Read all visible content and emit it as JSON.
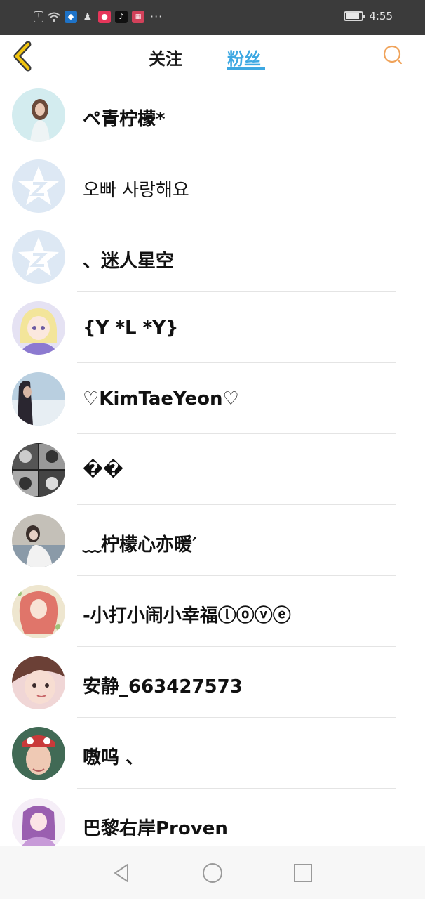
{
  "status_bar": {
    "time": "4:55",
    "icons": [
      "alert-icon",
      "wifi-icon",
      "shield-app-icon",
      "qq-icon",
      "camera-app-icon",
      "tiktok-icon",
      "video-app-icon"
    ],
    "more": "···",
    "battery_level": 0.85
  },
  "header": {
    "back_icon": "back-chevron-icon",
    "tab_follow": "关注",
    "tab_fans": "粉丝",
    "active_tab": "粉丝",
    "search_icon": "search-icon",
    "accent": "#3da8e2"
  },
  "fans": [
    {
      "name": "ペ青柠檬*",
      "avatar": "photo-girl"
    },
    {
      "name": "오빠 사랑해요",
      "avatar": "default-z"
    },
    {
      "name": "、迷人星空",
      "avatar": "default-z"
    },
    {
      "name": "{Y *L *Y}",
      "avatar": "anime-girl"
    },
    {
      "name": "♡KimTaeYeon♡",
      "avatar": "photo-dark"
    },
    {
      "name": "��",
      "avatar": "photo-grid"
    },
    {
      "name": "﹏柠檬心亦暖′",
      "avatar": "photo-sitting"
    },
    {
      "name": "-小打小闹小幸福ⓛⓞⓥⓔ",
      "avatar": "anime-red"
    },
    {
      "name": "安静_663427573",
      "avatar": "photo-face"
    },
    {
      "name": "嗷呜 、",
      "avatar": "photo-cap"
    },
    {
      "name": "巴黎右岸Proven",
      "avatar": "anime-purple"
    }
  ],
  "nav": {
    "back": "nav-back-icon",
    "home": "nav-home-icon",
    "recent": "nav-recent-icon"
  }
}
